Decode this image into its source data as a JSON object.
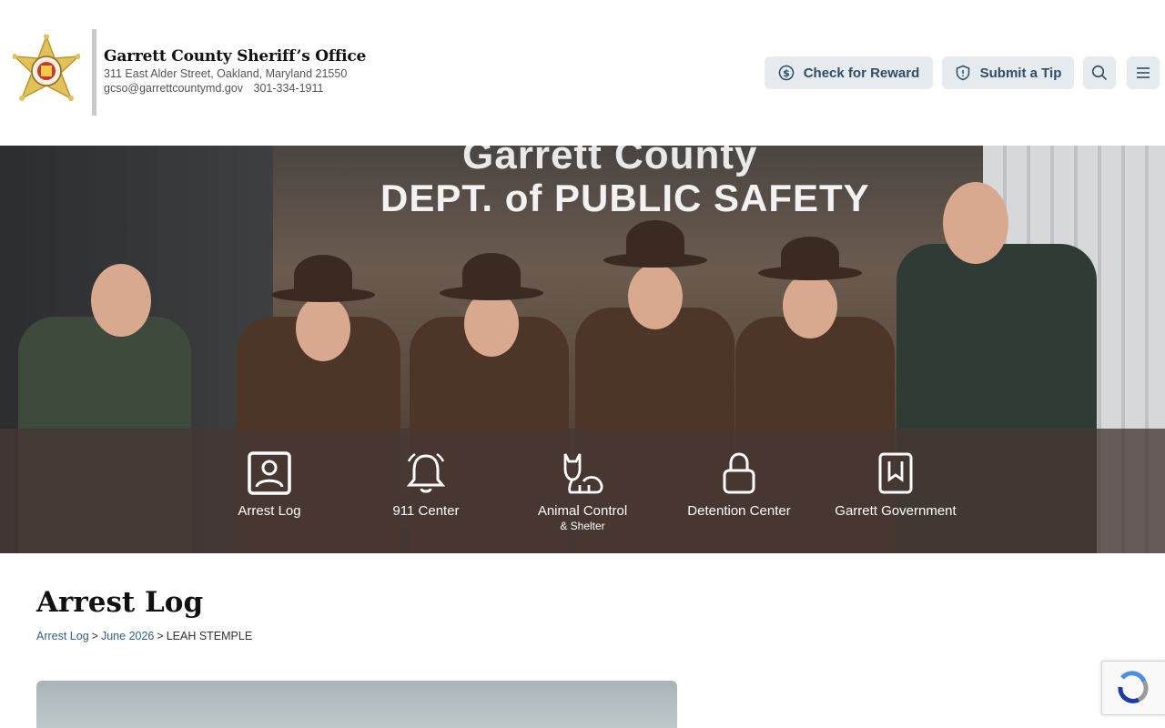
{
  "header": {
    "org_name": "Garrett County Sheriff’s Office",
    "address": "311 East Alder Street, Oakland, Maryland 21550",
    "email": "gcso@garrettcountymd.gov",
    "phone": "301-334-1911",
    "buttons": {
      "reward": "Check for Reward",
      "tip": "Submit a Tip"
    }
  },
  "hero": {
    "sign_line1": "Garrett County",
    "sign_line2": "DEPT. of PUBLIC SAFETY",
    "quick_links": [
      {
        "label": "Arrest Log",
        "sub": "",
        "icon": "id-card-icon"
      },
      {
        "label": "911 Center",
        "sub": "",
        "icon": "bell-icon"
      },
      {
        "label": "Animal Control",
        "sub": "& Shelter",
        "icon": "cat-icon"
      },
      {
        "label": "Detention Center",
        "sub": "",
        "icon": "lock-icon"
      },
      {
        "label": "Garrett Government",
        "sub": "",
        "icon": "bookmark-book-icon"
      }
    ]
  },
  "main": {
    "title": "Arrest Log",
    "breadcrumb": {
      "item1": "Arrest Log",
      "item2": "June 2026",
      "current": "LEAH STEMPLE",
      "separator": ">"
    }
  },
  "colors": {
    "button_bg": "#e6ebef",
    "button_text": "#2f4d64",
    "link": "#2e5f8a",
    "overlay": "#463734"
  }
}
